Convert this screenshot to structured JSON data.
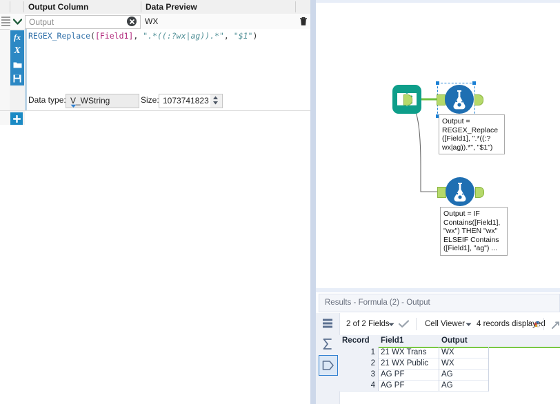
{
  "config_panel": {
    "columns": [
      {
        "label": "Output Column"
      },
      {
        "label": "Data Preview"
      }
    ],
    "row": {
      "output_column_value": "Output",
      "output_column_placeholder": "Output",
      "data_preview_value": "WX",
      "clear_icon": "clear-circle-icon",
      "delete_icon": "trash-icon",
      "drag_handle_icon": "drag-handle-icon",
      "expand_icon": "chevron-down-icon"
    },
    "editor": {
      "tools": [
        {
          "name": "function-icon",
          "glyph": "fx"
        },
        {
          "name": "variable-icon",
          "glyph": "X"
        },
        {
          "name": "open-icon",
          "glyph": "folder"
        },
        {
          "name": "save-icon",
          "glyph": "floppy"
        }
      ],
      "formula_tokens": [
        {
          "text": "REGEX_Replace",
          "type": "fn"
        },
        {
          "text": "(",
          "type": "pun"
        },
        {
          "text": "[Field1]",
          "type": "fld"
        },
        {
          "text": ", ",
          "type": "pun"
        },
        {
          "text": "\".*((:?wx|ag)).*\"",
          "type": "str"
        },
        {
          "text": ", ",
          "type": "pun"
        },
        {
          "text": "\"$1\"",
          "type": "str"
        },
        {
          "text": ")",
          "type": "pun"
        }
      ],
      "formula_plain": "REGEX_Replace([Field1], \".*((:?wx|ag)).*\", \"$1\")"
    },
    "data_type": {
      "label": "Data type:",
      "value": "V_WString",
      "size_label": "Size:",
      "size_value": "1073741823"
    },
    "add_button": {
      "name": "add-formula-button",
      "glyph": "+"
    }
  },
  "canvas": {
    "nodes": [
      {
        "id": "text-input",
        "icon": "book-icon",
        "selected": false,
        "annotation": ""
      },
      {
        "id": "formula-1",
        "icon": "flask-icon",
        "selected": true,
        "annotation": "Output = REGEX_Replace ([Field1], \".*((:? wx|ag)).*\", \"$1\")",
        "annotation_lines": [
          "Output =",
          "REGEX_Replace",
          "([Field1], \".*((:?",
          "wx|ag)).*\", \"$1\")"
        ]
      },
      {
        "id": "formula-2",
        "icon": "flask-icon",
        "selected": false,
        "annotation": "Output = IF Contains([Field1], \"wx\") THEN \"wx\" ELSEIF Contains ([Field1], \"ag\") ...",
        "annotation_lines": [
          "Output = IF",
          "Contains([Field1],",
          "\"wx\") THEN \"wx\"",
          "ELSEIF Contains",
          "([Field1], \"ag\") ..."
        ]
      }
    ],
    "colors": {
      "text_input_node": "#0e9e8a",
      "formula_node": "#1f6fb2",
      "port": "#b5d96a",
      "connector": "#6fbf3f",
      "selection": "#1a7fd4"
    }
  },
  "results": {
    "title_prefix": "Results",
    "title": "Results - Formula (2) - Output",
    "toolbar": {
      "fields_label": "2 of 2 Fields",
      "fields_caret": "chevron-down-icon",
      "check_icon": "checkmark-icon",
      "viewer_label": "Cell Viewer",
      "viewer_caret": "chevron-down-icon",
      "records_label": "4 records displayed"
    },
    "side_icons": [
      {
        "name": "table-view-icon",
        "selected": false
      },
      {
        "name": "sigma-icon",
        "selected": false
      },
      {
        "name": "tag-view-icon",
        "selected": true
      }
    ],
    "table": {
      "columns": [
        "Record",
        "Field1",
        "Output"
      ],
      "rows": [
        {
          "record": "1",
          "field1": "21 WX Trans",
          "output": "WX"
        },
        {
          "record": "2",
          "field1": "21 WX Public",
          "output": "WX"
        },
        {
          "record": "3",
          "field1": "AG PF",
          "output": "AG"
        },
        {
          "record": "4",
          "field1": "AG PF",
          "output": "AG"
        }
      ]
    }
  }
}
